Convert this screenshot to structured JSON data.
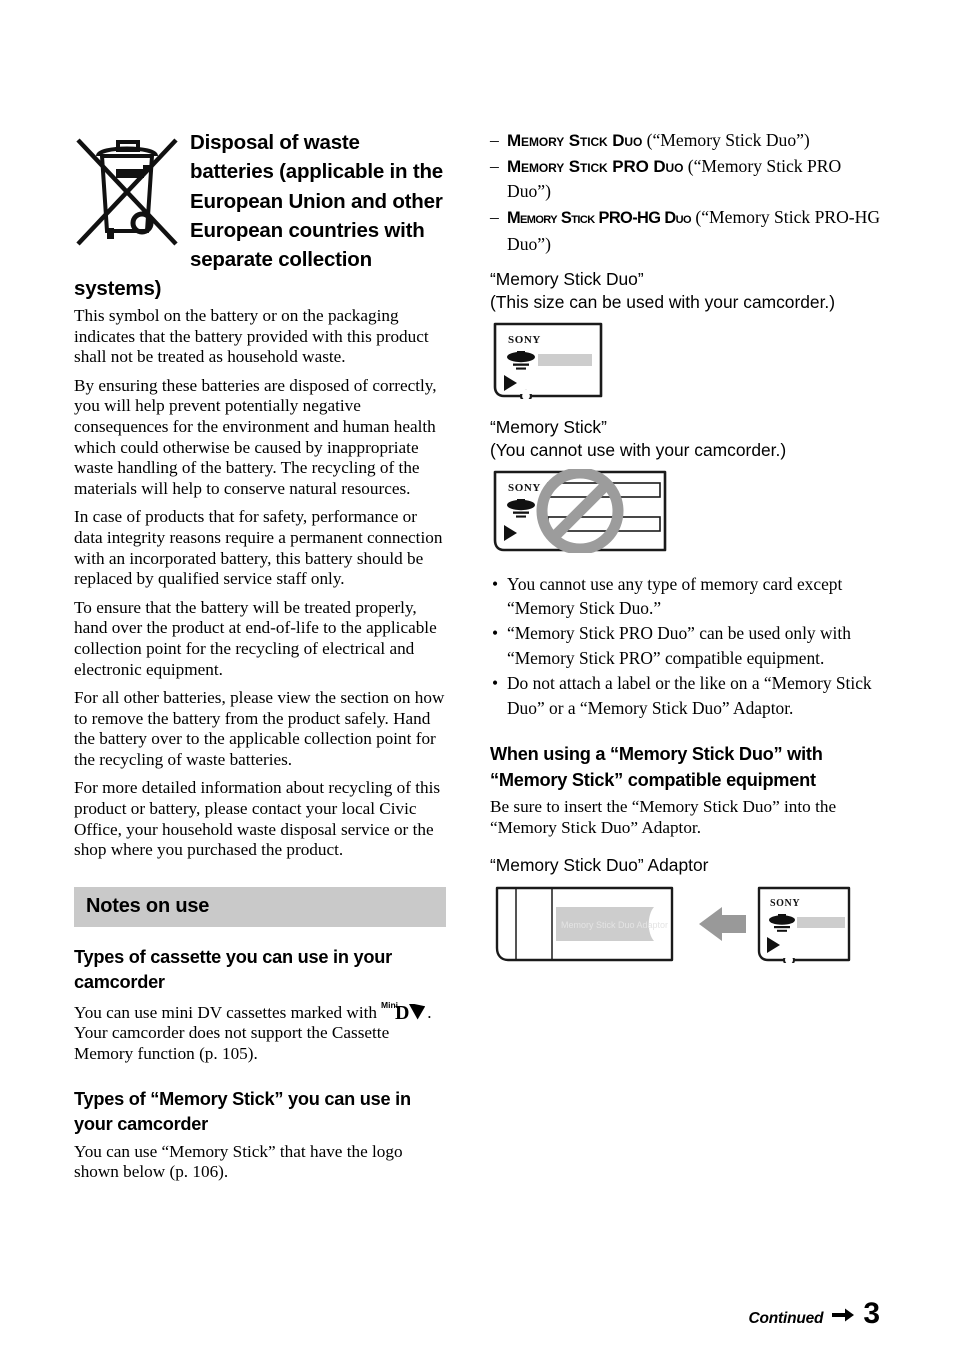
{
  "page": {
    "number": "3",
    "continued_label": "Continued",
    "continued_arrow_icon": "arrow-right-icon"
  },
  "left_column": {
    "disposal": {
      "icon": "crossed-out-wheelie-bin-icon",
      "heading": "Disposal of waste batteries (applicable in the European Union and other European countries with separate collection systems)",
      "paragraphs": [
        "This symbol on the battery or on the packaging indicates that the battery provided with this product shall not be treated as household waste.",
        "By ensuring these batteries are disposed of correctly, you will help prevent potentially negative consequences for the environment and human health which could otherwise be caused by inappropriate waste handling of the battery. The recycling of the materials will help to conserve natural resources.",
        "In case of products that for safety, performance or data integrity reasons require a permanent connection with an incorporated battery, this battery should be replaced by qualified service staff only.",
        "To ensure that the battery will be treated properly, hand over the product at end-of-life to the applicable collection point for the recycling of electrical and electronic equipment.",
        "For all other batteries, please view the section on how to remove the battery from the product safely. Hand the battery over to the applicable collection point for the recycling of waste batteries.",
        "For more detailed information about recycling of this product or battery, please contact your local Civic Office, your household waste disposal service or the shop where you purchased the product."
      ]
    },
    "notes_section": {
      "band_title": "Notes on use",
      "subsections": [
        {
          "heading": "Types of cassette you can use in your camcorder",
          "text_before_logo": "You can use mini DV cassettes marked with ",
          "logo_icon": "mini-dv-logo-icon",
          "logo_text": "MiniDV",
          "text_after_logo": ". Your camcorder does not support the Cassette Memory function (p. 105)."
        },
        {
          "heading": "Types of “Memory Stick” you can use in your camcorder",
          "text": "You can use “Memory Stick” that have the logo shown below (p. 106)."
        }
      ]
    }
  },
  "right_column": {
    "logo_list": [
      {
        "dash": "–",
        "logo": "Memory Stick Duo",
        "quoted": "(“Memory Stick Duo”)"
      },
      {
        "dash": "–",
        "logo": "Memory Stick PRO Duo",
        "quoted": "(“Memory Stick PRO Duo”)"
      },
      {
        "dash": "–",
        "logo": "Memory Stick PRO-HG Duo",
        "quoted": "(“Memory Stick PRO-HG Duo”)"
      }
    ],
    "duo_figure": {
      "caption_line1": "“Memory Stick Duo”",
      "caption_line2": "(This size can be used with your camcorder.)",
      "card_brand": "SONY",
      "icon": "memory-stick-duo-card-icon"
    },
    "ms_figure": {
      "caption_line1": "“Memory Stick”",
      "caption_line2": "(You cannot use with your camcorder.)",
      "card_brand": "SONY",
      "icon": "memory-stick-card-prohibited-icon",
      "prohibition_color": "#9c9c9c"
    },
    "bullets": [
      "You cannot use any type of memory card except “Memory Stick Duo.”",
      "“Memory Stick PRO Duo” can be used only with “Memory Stick PRO” compatible equipment.",
      "Do not attach a label or the like on a “Memory Stick Duo” or a “Memory Stick Duo” Adaptor."
    ],
    "adaptor_section": {
      "heading": "When using a “Memory Stick Duo” with “Memory Stick” compatible equipment",
      "paragraph": "Be sure to insert the “Memory Stick Duo” into the “Memory Stick Duo” Adaptor.",
      "figure_caption": "“Memory Stick Duo” Adaptor",
      "adaptor_label": "Memory Stick Duo Adaptor",
      "arrow_icon": "arrow-left-icon",
      "card_brand": "SONY",
      "band_color": "#cdcdcd"
    }
  }
}
